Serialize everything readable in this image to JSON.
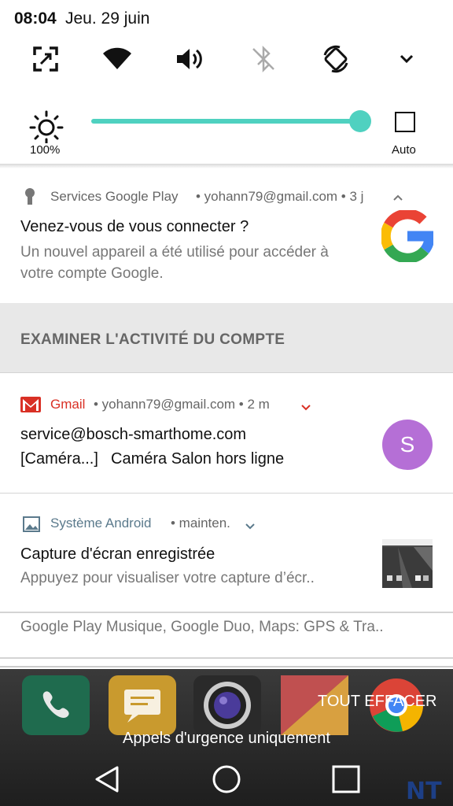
{
  "status_bar": {
    "time": "08:04",
    "date": "Jeu. 29 juin"
  },
  "quick_settings": {
    "icons": [
      "screen-expand-icon",
      "wifi-icon",
      "volume-icon",
      "bluetooth-off-icon",
      "auto-rotate-icon",
      "expand-chevron-icon"
    ]
  },
  "brightness": {
    "level": 1.0,
    "percent_label": "100%",
    "auto_label": "Auto"
  },
  "notifications": [
    {
      "app": "Services Google Play",
      "meta_rest": "• yohann79@gmail.com • 3 j",
      "title": "Venez-vous de vous connecter ?",
      "body": "Un nouvel appareil a été utilisé pour accéder à votre compte Google.",
      "action": "EXAMINER L'ACTIVITÉ DU COMPTE"
    },
    {
      "app": "Gmail",
      "meta_rest": "• yohann79@gmail.com • 2 m",
      "title": "service@bosch-smarthome.com",
      "body_tag": "[Caméra...]",
      "body": "Caméra Salon hors ligne",
      "avatar_letter": "S"
    },
    {
      "app": "Système Android",
      "meta_rest": "• mainten.",
      "title": "Capture d'écran enregistrée",
      "body": "Appuyez pour visualiser votre capture d’écr.."
    },
    {
      "summary": "Google Play Musique, Google Duo, Maps: GPS & Tra.."
    }
  ],
  "footer": {
    "clear_all": "TOUT EFFACER",
    "emergency": "Appels d'urgence uniquement",
    "watermark": "NT"
  },
  "colors": {
    "accent": "#4fd1c0",
    "gmail_red": "#d93025",
    "android_blue": "#5b7a8c",
    "avatar": "#b56fd6"
  }
}
